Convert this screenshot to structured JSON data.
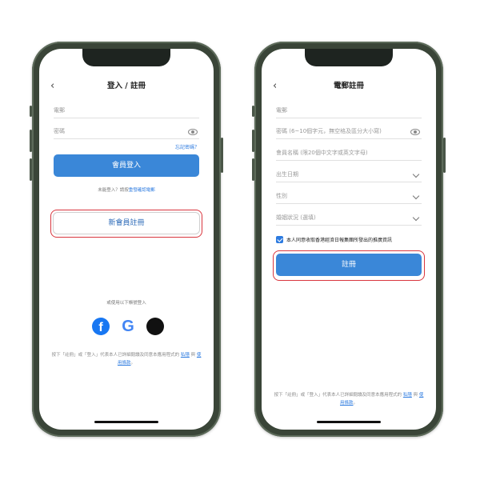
{
  "login_screen": {
    "title": "登入 / 註冊",
    "back_icon": "chevron-left-icon",
    "phone_placeholder": "電郵",
    "password_placeholder": "密碼",
    "forgot_password": "忘記密碼？",
    "login_button": "會員登入",
    "verify_note_prefix": "未能登入？請按",
    "verify_note_link": "重發確認電郵",
    "register_button": "新會員註冊",
    "social_prompt": "或使用以下帳號登入",
    "social_icons": [
      "facebook-icon",
      "google-icon",
      "apple-icon"
    ],
    "facebook_glyph": "f",
    "google_glyph": "G",
    "apple_glyph": "",
    "terms_text": "按下「註冊」或「登入」代表本人已詳細閱讀及同意本應用程式的",
    "privacy_link": "私隱",
    "terms_and": "與",
    "usage_link": "使用條款",
    "terms_end": "。"
  },
  "register_screen": {
    "title": "電郵註冊",
    "email_placeholder": "電郵",
    "password_placeholder": "密碼 (6~10個字元，無空格及區分大小寫)",
    "member_name_placeholder": "會員名稱 (限20個中文字或英文字母)",
    "dob_placeholder": "出生日期",
    "gender_placeholder": "性別",
    "marital_placeholder": "婚姻狀況 (選填)",
    "consent_label": "本人同意收取香港經濟日報集團所發出的推廣資訊",
    "register_button": "註冊",
    "terms_text": "按下「註冊」或「登入」代表本人已詳細閱讀及同意本應用程式的",
    "privacy_link": "私隱",
    "terms_and": "與",
    "usage_link": "使用條款",
    "terms_end": "。"
  },
  "colors": {
    "primary": "#3a87d8",
    "link": "#2d7be0",
    "highlight": "#d9363e",
    "phone_frame": "#3a4538"
  }
}
